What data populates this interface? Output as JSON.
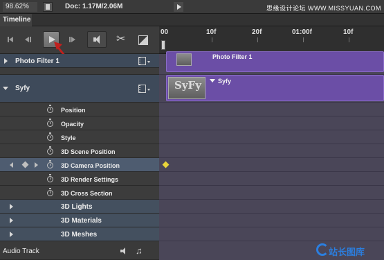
{
  "status_bar": {
    "zoom": "98.62%",
    "doc_info": "Doc: 1.17M/2.06M",
    "watermark": "思缘设计论坛 WWW.MISSYUAN.COM"
  },
  "panel": {
    "tab_label": "Timeline"
  },
  "ruler": {
    "labels": [
      "00",
      "10f",
      "20f",
      "01:00f",
      "10f"
    ]
  },
  "layers": [
    {
      "name": "Photo Filter 1",
      "expanded": false
    },
    {
      "name": "Syfy",
      "expanded": true
    }
  ],
  "properties": [
    {
      "label": "Position"
    },
    {
      "label": "Opacity"
    },
    {
      "label": "Style"
    },
    {
      "label": "3D Scene Position"
    },
    {
      "label": "3D Camera Position",
      "highlighted": true
    },
    {
      "label": "3D Render Settings"
    },
    {
      "label": "3D Cross Section"
    }
  ],
  "groups": [
    {
      "label": "3D Lights"
    },
    {
      "label": "3D Materials"
    },
    {
      "label": "3D Meshes"
    }
  ],
  "audio_track": {
    "label": "Audio Track"
  },
  "clips": {
    "photo_filter_label": "Photo Filter 1",
    "syfy_label": "Syfy",
    "syfy_thumb_text": "SyFy"
  },
  "logo": {
    "text": "站长图库"
  },
  "colors": {
    "clip_purple": "#6b4ea6",
    "keyframe_yellow": "#e8d43a",
    "highlight_row": "#4e5c70",
    "annotation_red": "#c0201e"
  },
  "icons": {
    "play": "play-icon",
    "scissors": "scissors-icon",
    "stopwatch": "stopwatch-icon",
    "film": "film-icon",
    "speaker": "speaker-icon",
    "note": "music-note-icon"
  }
}
